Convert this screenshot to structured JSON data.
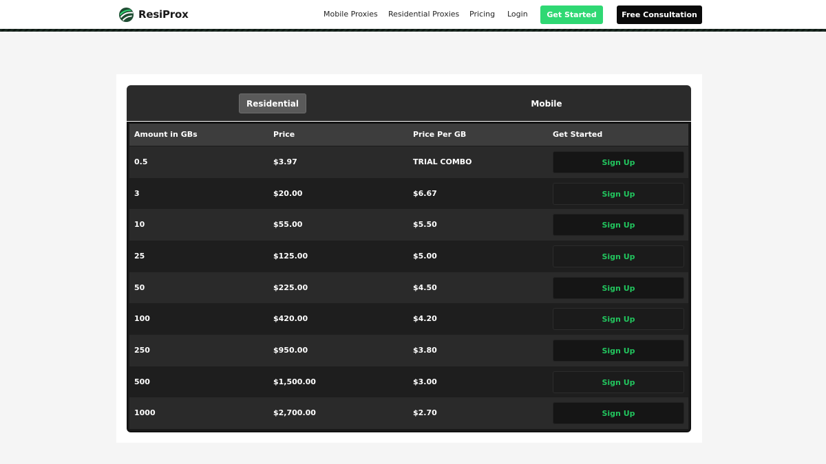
{
  "brand": {
    "name": "ResiProx",
    "accent": "#2fd873",
    "logo_icon": "leaf-globe-icon"
  },
  "nav": {
    "links": [
      "Mobile Proxies",
      "Residential Proxies",
      "Pricing",
      "Login"
    ],
    "get_started": "Get Started",
    "consultation": "Free Consultation"
  },
  "tabs": {
    "residential": "Residential",
    "mobile": "Mobile",
    "active": "Residential"
  },
  "table": {
    "headers": [
      "Amount in GBs",
      "Price",
      "Price Per GB",
      "Get Started"
    ],
    "rows": [
      {
        "amount": "0.5",
        "price": "$3.97",
        "per_gb": "TRIAL COMBO",
        "action": "Sign Up"
      },
      {
        "amount": "3",
        "price": "$20.00",
        "per_gb": "$6.67",
        "action": "Sign Up"
      },
      {
        "amount": "10",
        "price": "$55.00",
        "per_gb": "$5.50",
        "action": "Sign Up"
      },
      {
        "amount": "25",
        "price": "$125.00",
        "per_gb": "$5.00",
        "action": "Sign Up"
      },
      {
        "amount": "50",
        "price": "$225.00",
        "per_gb": "$4.50",
        "action": "Sign Up"
      },
      {
        "amount": "100",
        "price": "$420.00",
        "per_gb": "$4.20",
        "action": "Sign Up"
      },
      {
        "amount": "250",
        "price": "$950.00",
        "per_gb": "$3.80",
        "action": "Sign Up"
      },
      {
        "amount": "500",
        "price": "$1,500.00",
        "per_gb": "$3.00",
        "action": "Sign Up"
      },
      {
        "amount": "1000",
        "price": "$2,700.00",
        "per_gb": "$2.70",
        "action": "Sign Up"
      }
    ]
  }
}
